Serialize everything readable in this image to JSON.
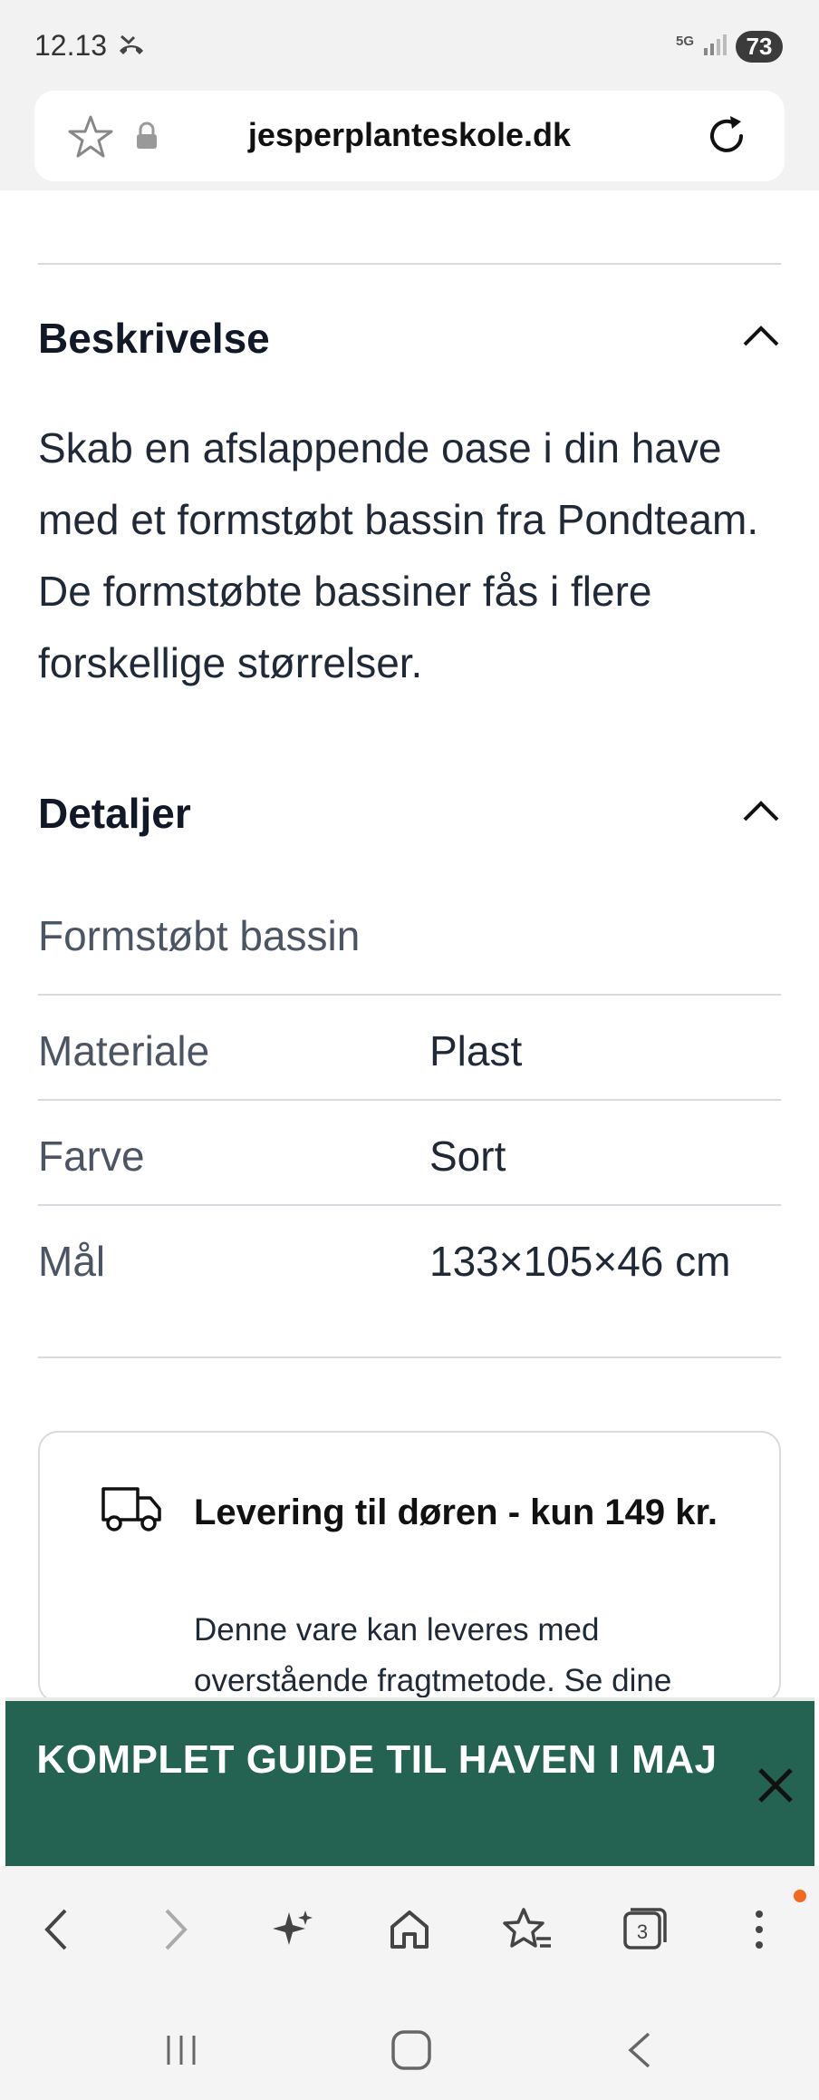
{
  "status": {
    "time": "12.13",
    "network": "5G",
    "battery": "73"
  },
  "browser": {
    "url": "jesperplanteskole.dk"
  },
  "description": {
    "title": "Beskrivelse",
    "text": "Skab en afslappende oase i din have med et formstøbt bassin fra Pondteam. De formstøbte bassiner fås i flere forskellige størrelser."
  },
  "details": {
    "title": "Detaljer",
    "group": "Formstøbt bassin",
    "rows": [
      {
        "label": "Materiale",
        "value": "Plast"
      },
      {
        "label": "Farve",
        "value": "Sort"
      },
      {
        "label": "Mål",
        "value": "133×105×46 cm"
      }
    ]
  },
  "delivery": {
    "title": "Levering til døren - kun 149 kr.",
    "text": "Denne vare kan leveres med overstående fragtmetode. Se dine"
  },
  "promo": {
    "text": "KOMPLET GUIDE TIL HAVEN I MAJ"
  },
  "toolbar": {
    "tab_count": "3"
  },
  "colors": {
    "promo_bg": "#246352",
    "notification_dot": "#f26a21"
  }
}
